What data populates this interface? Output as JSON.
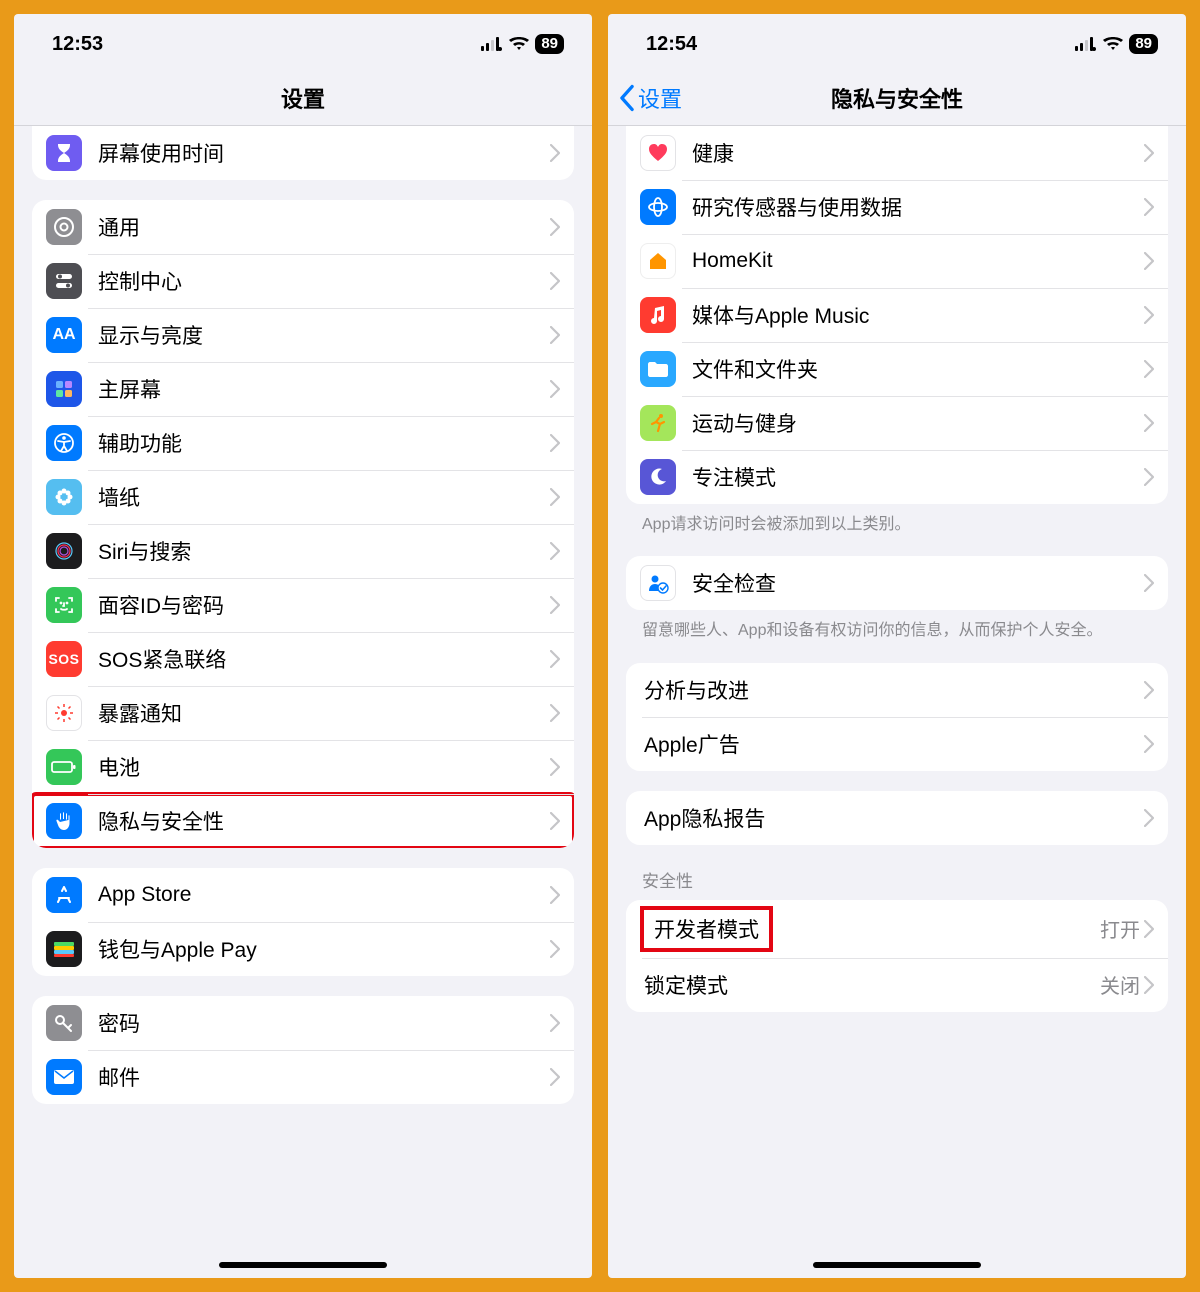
{
  "phone1": {
    "status": {
      "time": "12:53",
      "battery": "89"
    },
    "nav": {
      "title": "设置"
    },
    "group0": [
      {
        "label": "屏幕使用时间",
        "icon": "hourglass-icon",
        "bg": "bg-purple"
      }
    ],
    "group1": [
      {
        "label": "通用",
        "icon": "gear-icon",
        "bg": "bg-gray"
      },
      {
        "label": "控制中心",
        "icon": "switches-icon",
        "bg": "bg-darkgray"
      },
      {
        "label": "显示与亮度",
        "icon": "text-size-icon",
        "bg": "bg-blue"
      },
      {
        "label": "主屏幕",
        "icon": "apps-icon",
        "bg": "bg-blue"
      },
      {
        "label": "辅助功能",
        "icon": "accessibility-icon",
        "bg": "bg-blue"
      },
      {
        "label": "墙纸",
        "icon": "flower-icon",
        "bg": "bg-cyan"
      },
      {
        "label": "Siri与搜索",
        "icon": "siri-icon",
        "bg": "bg-black"
      },
      {
        "label": "面容ID与密码",
        "icon": "faceid-icon",
        "bg": "bg-green"
      },
      {
        "label": "SOS紧急联络",
        "icon": "sos-icon",
        "bg": "bg-red"
      },
      {
        "label": "暴露通知",
        "icon": "exposure-icon",
        "bg": "bg-white"
      },
      {
        "label": "电池",
        "icon": "battery-icon",
        "bg": "bg-green"
      },
      {
        "label": "隐私与安全性",
        "icon": "hand-icon",
        "bg": "bg-blue",
        "highlight": true
      }
    ],
    "group2": [
      {
        "label": "App Store",
        "icon": "appstore-icon",
        "bg": "bg-blue"
      },
      {
        "label": "钱包与Apple Pay",
        "icon": "wallet-icon",
        "bg": "bg-black"
      }
    ],
    "group3": [
      {
        "label": "密码",
        "icon": "key-icon",
        "bg": "bg-gray"
      },
      {
        "label": "邮件",
        "icon": "mail-icon",
        "bg": "bg-blue"
      }
    ]
  },
  "phone2": {
    "status": {
      "time": "12:54",
      "battery": "89"
    },
    "nav": {
      "back": "设置",
      "title": "隐私与安全性"
    },
    "group0": [
      {
        "label": "健康",
        "icon": "heart-icon",
        "bg": "bg-white"
      },
      {
        "label": "研究传感器与使用数据",
        "icon": "research-icon",
        "bg": "bg-blue"
      },
      {
        "label": "HomeKit",
        "icon": "home-icon",
        "bg": "bg-orange"
      },
      {
        "label": "媒体与Apple Music",
        "icon": "music-icon",
        "bg": "bg-red"
      },
      {
        "label": "文件和文件夹",
        "icon": "folder-icon",
        "bg": "bg-blue"
      },
      {
        "label": "运动与健身",
        "icon": "fitness-icon",
        "bg": "bg-lime"
      },
      {
        "label": "专注模式",
        "icon": "moon-icon",
        "bg": "bg-indigo"
      }
    ],
    "footer0": "App请求访问时会被添加到以上类别。",
    "group1": [
      {
        "label": "安全检查",
        "icon": "safety-check-icon",
        "bg": "bg-white"
      }
    ],
    "footer1": "留意哪些人、App和设备有权访问你的信息，从而保护个人安全。",
    "group2": [
      {
        "label": "分析与改进"
      },
      {
        "label": "Apple广告"
      }
    ],
    "group3": [
      {
        "label": "App隐私报告"
      }
    ],
    "header4": "安全性",
    "group4": [
      {
        "label": "开发者模式",
        "value": "打开",
        "highlightLabel": true
      },
      {
        "label": "锁定模式",
        "value": "关闭"
      }
    ]
  }
}
